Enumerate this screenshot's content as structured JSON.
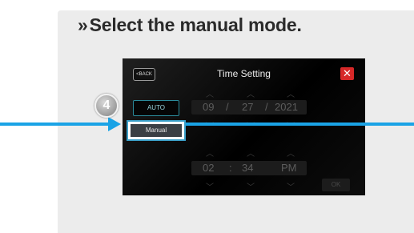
{
  "instruction": {
    "prefix": "»",
    "text": "Select the manual mode."
  },
  "screen": {
    "back_label": "BACK",
    "title": "Time Setting",
    "close_label": "✕",
    "auto_label": "AUTO",
    "manual_label": "Manual",
    "date": {
      "month": "09",
      "sep1": "/",
      "day": "27",
      "sep2": "/",
      "year": "2021"
    },
    "time": {
      "hour": "02",
      "sep": ":",
      "minute": "34",
      "ampm": "PM"
    },
    "ok_label": "OK"
  },
  "callout": {
    "step_number": "4",
    "arrow_color": "#1aa3e6"
  }
}
